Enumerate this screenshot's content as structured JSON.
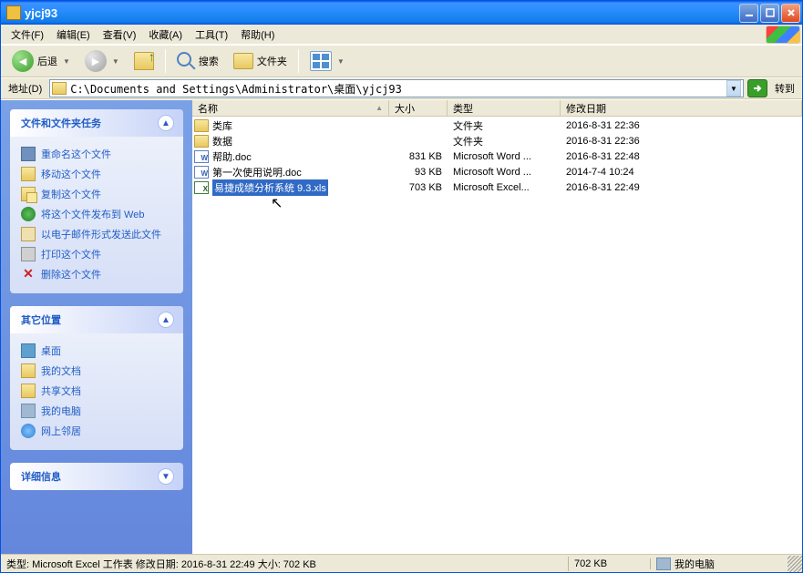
{
  "window": {
    "title": "yjcj93"
  },
  "menu": {
    "file": "文件(F)",
    "edit": "编辑(E)",
    "view": "查看(V)",
    "favorites": "收藏(A)",
    "tools": "工具(T)",
    "help": "帮助(H)"
  },
  "toolbar": {
    "back": "后退",
    "search": "搜索",
    "folders": "文件夹"
  },
  "addressbar": {
    "label": "地址(D)",
    "path": "C:\\Documents and Settings\\Administrator\\桌面\\yjcj93",
    "go": "转到"
  },
  "sidebar": {
    "panel1": {
      "title": "文件和文件夹任务",
      "links": [
        {
          "label": "重命名这个文件",
          "icon": "rename"
        },
        {
          "label": "移动这个文件",
          "icon": "move"
        },
        {
          "label": "复制这个文件",
          "icon": "copy"
        },
        {
          "label": "将这个文件发布到 Web",
          "icon": "web"
        },
        {
          "label": "以电子邮件形式发送此文件",
          "icon": "mail"
        },
        {
          "label": "打印这个文件",
          "icon": "print"
        },
        {
          "label": "删除这个文件",
          "icon": "delete"
        }
      ]
    },
    "panel2": {
      "title": "其它位置",
      "links": [
        {
          "label": "桌面",
          "icon": "desktop"
        },
        {
          "label": "我的文档",
          "icon": "mydocs"
        },
        {
          "label": "共享文档",
          "icon": "shared"
        },
        {
          "label": "我的电脑",
          "icon": "computer"
        },
        {
          "label": "网上邻居",
          "icon": "network"
        }
      ]
    },
    "panel3": {
      "title": "详细信息"
    }
  },
  "columns": {
    "name": "名称",
    "size": "大小",
    "type": "类型",
    "date": "修改日期"
  },
  "files": [
    {
      "name": "类库",
      "size": "",
      "type": "文件夹",
      "date": "2016-8-31 22:36",
      "icon": "folder",
      "selected": false
    },
    {
      "name": "数据",
      "size": "",
      "type": "文件夹",
      "date": "2016-8-31 22:36",
      "icon": "folder",
      "selected": false
    },
    {
      "name": "帮助.doc",
      "size": "831 KB",
      "type": "Microsoft Word ...",
      "date": "2016-8-31 22:48",
      "icon": "doc",
      "selected": false
    },
    {
      "name": "第一次使用说明.doc",
      "size": "93 KB",
      "type": "Microsoft Word ...",
      "date": "2014-7-4 10:24",
      "icon": "doc",
      "selected": false
    },
    {
      "name": "易捷成绩分析系统 9.3.xls",
      "size": "703 KB",
      "type": "Microsoft Excel...",
      "date": "2016-8-31 22:49",
      "icon": "xls",
      "selected": true
    }
  ],
  "statusbar": {
    "info": "类型: Microsoft Excel 工作表 修改日期: 2016-8-31 22:49 大小: 702 KB",
    "size": "702 KB",
    "location": "我的电脑"
  }
}
